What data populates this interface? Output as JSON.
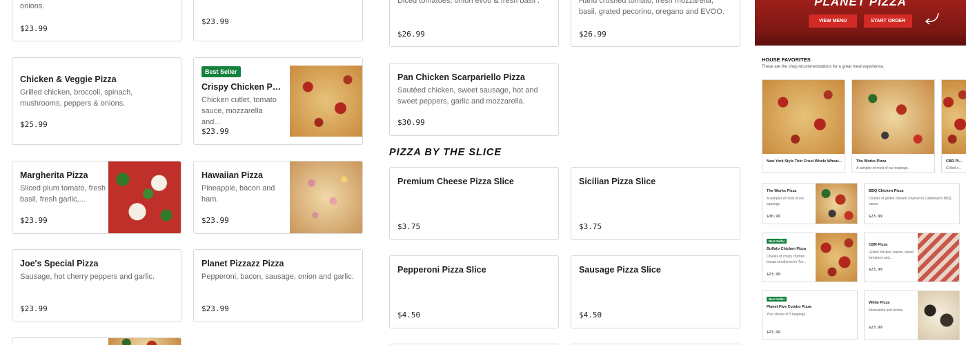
{
  "colors": {
    "badge_green": "#14813c",
    "brand_red": "#d32a25",
    "hero_dark": "#7c1713"
  },
  "left_cards": [
    {
      "title": "",
      "desc": "onions.",
      "price": "$23.99"
    },
    {
      "title": "",
      "desc": "",
      "price": "$23.99"
    },
    {
      "title": "Chicken & Veggie Pizza",
      "desc": "Grilled chicken, broccoli, spinach, mushrooms, peppers & onions.",
      "price": "$25.99"
    },
    {
      "badge": "Best Seller",
      "title": "Crispy Chicken Parm...",
      "desc": "Chicken cutlet, tomato sauce, mozzarella and...",
      "price": "$23.99",
      "image": "pizza-icon"
    },
    {
      "title": "Margherita Pizza",
      "desc": "Sliced plum tomato, fresh basil, fresh garlic,...",
      "price": "$23.99",
      "image": "pizza-icon"
    },
    {
      "title": "Hawaiian Pizza",
      "desc": "Pineapple, bacon and ham.",
      "price": "$23.99",
      "image": "pizza-icon"
    },
    {
      "title": "Joe's Special Pizza",
      "desc": "Sausage, hot cherry peppers and garlic.",
      "price": "$23.99"
    },
    {
      "title": "Planet Pizzazz Pizza",
      "desc": "Pepperoni, bacon, sausage, onion and garlic.",
      "price": "$23.99"
    }
  ],
  "mid_cards": [
    {
      "title": "",
      "desc": "Diced tomatoes, onion evoo & fresh basil .",
      "price": "$26.99"
    },
    {
      "title": "",
      "desc": "Hand crushed tomato, fresh mozzarella, basil, grated pecorino, oregano and EVOO.",
      "price": "$26.99"
    },
    {
      "title": "Pan Chicken Scarpariello Pizza",
      "desc": "Sautéed chicken, sweet sausage, hot and sweet peppers, garlic and mozzarella.",
      "price": "$30.99"
    }
  ],
  "slice_section": {
    "title": "PIZZA BY THE SLICE",
    "items": [
      {
        "title": "Premium Cheese Pizza Slice",
        "price": "$3.75"
      },
      {
        "title": "Sicilian Pizza Slice",
        "price": "$3.75"
      },
      {
        "title": "Pepperoni Pizza Slice",
        "price": "$4.50"
      },
      {
        "title": "Sausage Pizza Slice",
        "price": "$4.50"
      }
    ]
  },
  "preview": {
    "brand": "PLANET PIZZA",
    "view_menu": "VIEW MENU",
    "start_order": "START ORDER",
    "favorites_title": "HOUSE FAVORITES",
    "favorites_sub": "These are the shop recommendations for a great meal experience.",
    "carousel": [
      {
        "title": "New York Style Thin Crust Whole Wheat...",
        "desc": ""
      },
      {
        "title": "The Works Pizza",
        "desc": "A sampler of most of our toppings."
      },
      {
        "title": "CBR Pi...",
        "desc": "Grilled c..."
      }
    ],
    "grid": [
      {
        "title": "The Works Pizza",
        "desc": "A sampler of most of our toppings.",
        "price": "$30.99"
      },
      {
        "title": "BBQ Chicken Pizza",
        "desc": "Chunks of grilled chicken covered in Cattleman's BBQ sauce.",
        "price": "$23.99"
      },
      {
        "badge": "Best Seller",
        "title": "Buffalo Chicken Pizza",
        "desc": "Chunks of crispy chicken breast smothered in Tex...",
        "price": "$23.99"
      },
      {
        "title": "CBR Pizza",
        "desc": "Grilled chicken, bacon, sliced tomatoes and...",
        "price": "$23.99"
      },
      {
        "badge": "Best Seller",
        "title": "Planet Five Combo Pizza",
        "desc": "Your choice of 5 toppings.",
        "price": "$23.99"
      },
      {
        "title": "White Pizza",
        "desc": "Mozzarella and ricotta.",
        "price": "$23.99"
      }
    ]
  }
}
